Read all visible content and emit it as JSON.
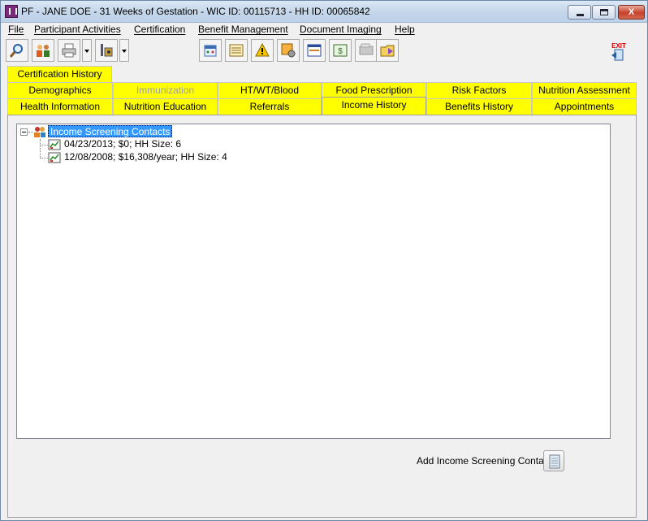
{
  "window": {
    "title": "PF - JANE DOE - 31 Weeks of Gestation - WIC ID: 00115713 - HH ID: 00065842",
    "min_glyph": "",
    "max_glyph": "",
    "close_glyph": "X"
  },
  "menu": {
    "file": "File",
    "participant_activities": "Participant Activities",
    "certification": "Certification",
    "benefit_management": "Benefit Management",
    "document_imaging": "Document Imaging",
    "help": "Help"
  },
  "toolbar": {
    "icons": [
      "search-icon",
      "participants-icon",
      "printer-icon",
      "tools-icon",
      "calendar-icon",
      "schedule-icon",
      "alert-icon",
      "settings-icon",
      "form-icon",
      "voucher-icon",
      "scanner-icon",
      "folder-icon",
      "exit-icon"
    ],
    "exit_label": "EXIT"
  },
  "tabs": {
    "row1": [
      "Certification History"
    ],
    "row2": [
      "Demographics",
      "Immunization",
      "HT/WT/Blood",
      "Food Prescription",
      "Risk Factors",
      "Nutrition Assessment"
    ],
    "row3": [
      "Health Information",
      "Nutrition Education",
      "Referrals",
      "Income History",
      "Benefits History",
      "Appointments"
    ],
    "active": "Income History",
    "disabled": [
      "Immunization"
    ],
    "color": "#ffff00"
  },
  "tree": {
    "root": "Income Screening Contacts",
    "children": [
      "04/23/2013; $0; HH Size: 6",
      "12/08/2008; $16,308/year; HH Size: 4"
    ]
  },
  "actions": {
    "add_label": "Add Income Screening Contact"
  },
  "colors": {
    "selection": "#3399ff",
    "tab_yellow": "#ffff00",
    "close_red": "#c6412b"
  }
}
